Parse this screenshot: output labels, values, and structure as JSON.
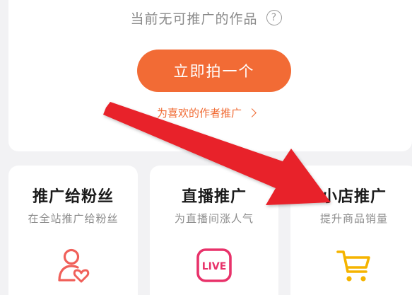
{
  "top": {
    "empty_text": "当前无可推广的作品",
    "help_glyph": "?",
    "shoot_button_label": "立即拍一个",
    "promo_link_label": "为喜欢的作者推广"
  },
  "features": [
    {
      "title": "推广给粉丝",
      "subtitle": "在全站推广给粉丝",
      "icon": "fans-user-heart-icon"
    },
    {
      "title": "直播推广",
      "subtitle": "为直播间涨人气",
      "icon": "live-icon",
      "icon_text": "LIVE"
    },
    {
      "title": "小店推广",
      "subtitle": "提升商品销量",
      "icon": "shopping-cart-icon"
    }
  ],
  "colors": {
    "accent": "#f26b35",
    "live_pink": "#e8326a",
    "fans_red": "#f0605a",
    "cart_yellow": "#f5b400",
    "annotation_arrow": "#e8232a"
  }
}
